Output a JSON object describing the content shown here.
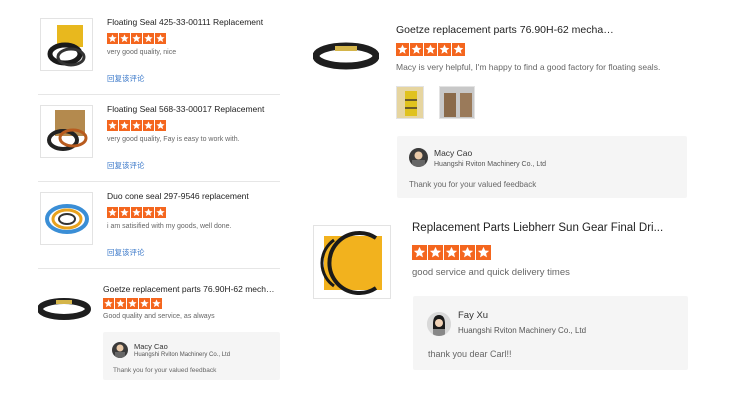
{
  "colors": {
    "star": "#f4661e",
    "link": "#3a78c9",
    "reply_bg": "#f5f5f5",
    "divider": "#e6e6e6"
  },
  "left_reviews": [
    {
      "title": "Floating Seal 425-33-00111 Replacement",
      "rating": 5,
      "comment": "very good quality, nice",
      "link": "回复该评论"
    },
    {
      "title": "Floating Seal 568-33-00017 Replacement",
      "rating": 5,
      "comment": "very good quality, Fay is easy to work with.",
      "link": "回复该评论"
    },
    {
      "title": "Duo cone seal 297-9546 replacement",
      "rating": 5,
      "comment": "i am satisified with my goods, well done.",
      "link": "回复该评论"
    },
    {
      "title": "Goetze replacement parts 76.90H-62 mechani...",
      "rating": 5,
      "comment": "Good quality and service, as always",
      "reply": {
        "name": "Macy Cao",
        "company": "Huangshi Rviton Machinery Co., Ltd",
        "text": "Thank you for your valued feedback"
      }
    }
  ],
  "right_reviews": [
    {
      "title": "Goetze replacement parts 76.90H-62 mechani...",
      "rating": 5,
      "comment": "Macy is very helpful, I'm happy to find a good factory for floating seals.",
      "reply": {
        "name": "Macy Cao",
        "company": "Huangshi Rviton Machinery Co., Ltd",
        "text": "Thank you for your valued feedback"
      }
    },
    {
      "title": "Replacement Parts Liebherr Sun Gear Final Dri...",
      "rating": 5,
      "comment": "good service and quick delivery times",
      "reply": {
        "name": "Fay Xu",
        "company": "Huangshi Rviton Machinery Co., Ltd",
        "text": "thank you dear Carl!!"
      }
    }
  ],
  "icons": [
    "floating-seal-product-icon",
    "star-icon",
    "avatar-icon"
  ]
}
